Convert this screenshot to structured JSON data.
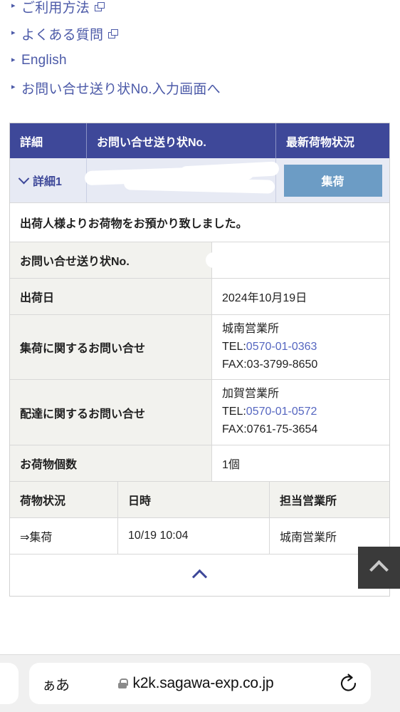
{
  "links": [
    {
      "label": "ご利用方法",
      "external": true,
      "bullet": "▸"
    },
    {
      "label": "よくある質問",
      "external": true,
      "bullet": "▸"
    },
    {
      "label": "English",
      "external": false,
      "bullet": "▸"
    },
    {
      "label": "お問い合せ送り状No.入力画面へ",
      "external": false,
      "bullet": "▸"
    }
  ],
  "table": {
    "headers": {
      "detail": "詳細",
      "number": "お問い合せ送り状No.",
      "status": "最新荷物状況"
    },
    "summary": {
      "detail_label": "詳細1",
      "detail_icon": "chevron-down-icon",
      "number_value": "",
      "status_badge": "集荷"
    },
    "notice": "出荷人様よりお荷物をお預かり致しました。",
    "rows": [
      {
        "label": "お問い合せ送り状No.",
        "value": "",
        "tall": false
      },
      {
        "label": "出荷日",
        "value": "2024年10月19日",
        "tall": false
      },
      {
        "label": "集荷に関するお問い合せ",
        "tall": true,
        "office": "城南営業所",
        "tel_prefix": "TEL:",
        "tel": "0570-01-0363",
        "fax": "FAX:03-3799-8650"
      },
      {
        "label": "配達に関するお問い合せ",
        "tall": true,
        "office": "加賀営業所",
        "tel_prefix": "TEL:",
        "tel": "0570-01-0572",
        "fax": "FAX:0761-75-3654"
      },
      {
        "label": "お荷物個数",
        "value": "1個",
        "tall": false
      }
    ],
    "history": {
      "headers": [
        "荷物状況",
        "日時",
        "担当営業所"
      ],
      "rows": [
        {
          "status": "⇒集荷",
          "datetime": "10/19 10:04",
          "office": "城南営業所"
        }
      ]
    },
    "collapse_icon": "chevron-up-icon"
  },
  "floating": {
    "scroll_top_icon": "chevron-up-icon"
  },
  "browser": {
    "text_size_label": "ぁあ",
    "lock_icon": "lock-icon",
    "url": "k2k.sagawa-exp.co.jp",
    "reload_icon": "reload-icon"
  },
  "colors": {
    "header_navy": "#3e4899",
    "summary_bg": "#e7eaf4",
    "badge_blue": "#6c9cc5",
    "label_bg": "#f2f2ee",
    "link_blue": "#4c5aa8",
    "tel_blue": "#5566c0"
  }
}
